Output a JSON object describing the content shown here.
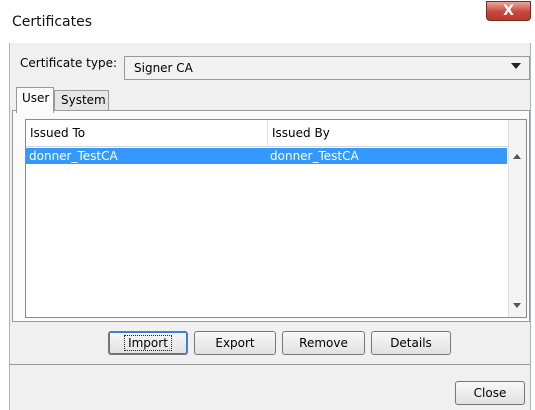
{
  "window": {
    "title": "Certificates",
    "close_glyph": "X"
  },
  "cert_type": {
    "label": "Certificate type:",
    "value": "Signer CA"
  },
  "tabs": [
    {
      "label": "User",
      "selected": true
    },
    {
      "label": "System",
      "selected": false
    }
  ],
  "table": {
    "columns": [
      "Issued To",
      "Issued By"
    ],
    "rows": [
      {
        "issued_to": "donner_TestCA",
        "issued_by": "donner_TestCA",
        "selected": true
      }
    ]
  },
  "actions": {
    "import": "Import",
    "export": "Export",
    "remove": "Remove",
    "details": "Details"
  },
  "footer": {
    "close": "Close"
  },
  "colors": {
    "selection": "#3399ff",
    "title_close": "#c8473a"
  }
}
